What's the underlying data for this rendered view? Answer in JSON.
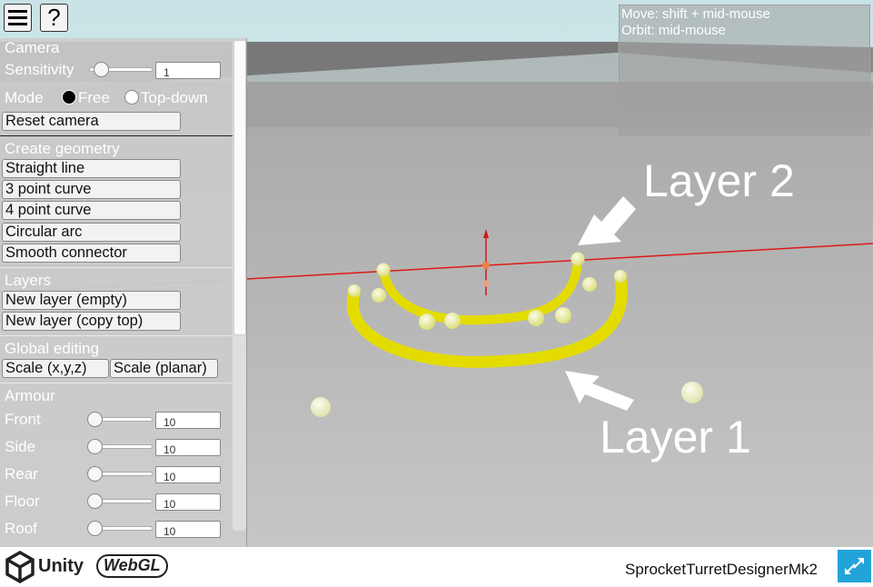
{
  "toolbar": {
    "menu_icon": "hamburger-menu-icon",
    "help_label": "?"
  },
  "camera": {
    "section": "Camera",
    "sensitivity_label": "Sensitivity",
    "sensitivity_value": "1",
    "sensitivity_level": 0.15,
    "mode_label": "Mode",
    "mode_options": [
      "Free",
      "Top-down"
    ],
    "mode_selected": "Free",
    "reset_label": "Reset camera"
  },
  "geometry": {
    "section": "Create geometry",
    "buttons": [
      "Straight line",
      "3 point curve",
      "4 point curve",
      "Circular arc",
      "Smooth connector"
    ]
  },
  "layers": {
    "section": "Layers",
    "buttons": [
      "New layer (empty)",
      "New layer (copy top)"
    ]
  },
  "global_editing": {
    "section": "Global editing",
    "buttons": [
      "Scale (x,y,z)",
      "Scale (planar)"
    ]
  },
  "armour": {
    "section": "Armour",
    "rows": [
      {
        "label": "Front",
        "value": "10",
        "level": 0
      },
      {
        "label": "Side",
        "value": "10",
        "level": 0
      },
      {
        "label": "Rear",
        "value": "10",
        "level": 0
      },
      {
        "label": "Floor",
        "value": "10",
        "level": 0
      },
      {
        "label": "Roof",
        "value": "10",
        "level": 0
      }
    ]
  },
  "help": {
    "lines": [
      "Move: shift + mid-mouse",
      "Orbit: mid-mouse"
    ]
  },
  "annotations": {
    "layer2": "Layer 2",
    "layer1": "Layer 1"
  },
  "footer": {
    "unity_label": "Unity",
    "webgl_label": "WebGL",
    "app_name": "SprocketTurretDesignerMk2"
  },
  "colors": {
    "curve": "#e8e000",
    "node": "#f2f4a0",
    "axis": "#e01818",
    "panel": "#cdcdcd",
    "accent": "#23a4d9"
  }
}
